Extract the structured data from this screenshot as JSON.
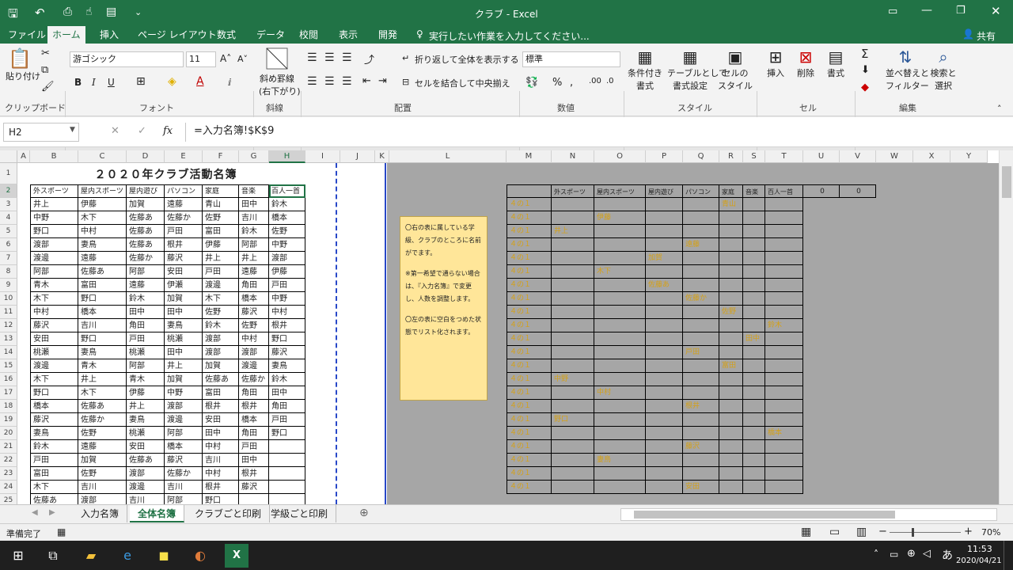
{
  "window": {
    "title": "クラブ - Excel",
    "share": "共有"
  },
  "tabs": [
    "ファイル",
    "ホーム",
    "挿入",
    "ページ レイアウト",
    "数式",
    "データ",
    "校閲",
    "表示",
    "開発"
  ],
  "tell_me": "実行したい作業を入力してください...",
  "ribbon": {
    "paste": "貼り付け",
    "clipboard": "クリップボード",
    "font_name": "游ゴシック",
    "font_size": "11",
    "font": "フォント",
    "diagonal": "斜め罫線",
    "diagonal2": "(右下がり)",
    "diagonal_group": "斜線",
    "wrap": "折り返して全体を表示する",
    "merge": "セルを結合して中央揃え",
    "alignment": "配置",
    "number_format": "標準",
    "number": "数値",
    "cond_format": "条件付き",
    "cond_format2": "書式",
    "table_format": "テーブルとして",
    "table_format2": "書式設定",
    "cell_style": "セルの",
    "cell_style2": "スタイル",
    "style": "スタイル",
    "insert": "挿入",
    "delete": "削除",
    "format": "書式",
    "cells": "セル",
    "sort": "並べ替えと",
    "sort2": "フィルター",
    "find": "検索と",
    "find2": "選択",
    "editing": "編集",
    "bold": "B",
    "italic": "I",
    "underline": "U"
  },
  "formula_bar": {
    "name_box": "H2",
    "formula": "=入力名簿!$K$9"
  },
  "columns": [
    "A",
    "B",
    "C",
    "D",
    "E",
    "F",
    "G",
    "H",
    "I",
    "J",
    "K",
    "L",
    "M",
    "N",
    "O",
    "P",
    "Q",
    "R",
    "S",
    "T",
    "U",
    "V",
    "W",
    "X",
    "Y"
  ],
  "rows": [
    "1",
    "2",
    "3",
    "4",
    "5",
    "6",
    "7",
    "8",
    "9",
    "10",
    "11",
    "12",
    "13",
    "14",
    "15",
    "16",
    "17",
    "18",
    "19",
    "20",
    "21",
    "22",
    "23",
    "24",
    "25"
  ],
  "table_title": "２０２０年クラブ活動名簿",
  "left_headers": [
    "外スポーツ",
    "屋内スポーツ",
    "屋内遊び",
    "パソコン",
    "家庭",
    "音楽",
    "百人一首"
  ],
  "left_rows": [
    [
      "井上",
      "伊藤",
      "加賀",
      "遠藤",
      "青山",
      "田中",
      "鈴木"
    ],
    [
      "中野",
      "木下",
      "佐藤あ",
      "佐藤か",
      "佐野",
      "吉川",
      "橋本"
    ],
    [
      "野口",
      "中村",
      "佐藤あ",
      "戸田",
      "富田",
      "鈴木",
      "佐野"
    ],
    [
      "渡部",
      "妻鳥",
      "佐藤あ",
      "根井",
      "伊藤",
      "阿部",
      "中野"
    ],
    [
      "渡邊",
      "遠藤",
      "佐藤か",
      "藤沢",
      "井上",
      "井上",
      "渡部"
    ],
    [
      "阿部",
      "佐藤あ",
      "阿部",
      "安田",
      "戸田",
      "遠藤",
      "伊藤"
    ],
    [
      "青木",
      "富田",
      "遠藤",
      "伊瀬",
      "渡邊",
      "角田",
      "戸田"
    ],
    [
      "木下",
      "野口",
      "鈴木",
      "加賀",
      "木下",
      "橋本",
      "中野"
    ],
    [
      "中村",
      "橋本",
      "田中",
      "田中",
      "佐野",
      "藤沢",
      "中村"
    ],
    [
      "藤沢",
      "吉川",
      "角田",
      "妻鳥",
      "鈴木",
      "佐野",
      "根井"
    ],
    [
      "安田",
      "野口",
      "戸田",
      "桃瀬",
      "渡部",
      "中村",
      "野口"
    ],
    [
      "桃瀬",
      "妻鳥",
      "桃瀬",
      "田中",
      "渡部",
      "渡部",
      "藤沢"
    ],
    [
      "渡邊",
      "青木",
      "阿部",
      "井上",
      "加賀",
      "渡邊",
      "妻鳥"
    ],
    [
      "木下",
      "井上",
      "青木",
      "加賀",
      "佐藤あ",
      "佐藤か",
      "鈴木"
    ],
    [
      "野口",
      "木下",
      "伊藤",
      "中野",
      "富田",
      "角田",
      "田中"
    ],
    [
      "橋本",
      "佐藤あ",
      "井上",
      "渡部",
      "根井",
      "根井",
      "角田"
    ],
    [
      "藤沢",
      "佐藤か",
      "妻鳥",
      "渡邊",
      "安田",
      "橋本",
      "戸田"
    ],
    [
      "妻鳥",
      "佐野",
      "桃瀬",
      "阿部",
      "田中",
      "角田",
      "野口"
    ],
    [
      "鈴木",
      "遠藤",
      "安田",
      "橋本",
      "中村",
      "戸田",
      ""
    ],
    [
      "戸田",
      "加賀",
      "佐藤あ",
      "藤沢",
      "吉川",
      "田中",
      ""
    ],
    [
      "富田",
      "佐野",
      "渡部",
      "佐藤か",
      "中村",
      "根井",
      ""
    ],
    [
      "木下",
      "吉川",
      "渡邊",
      "吉川",
      "根井",
      "藤沢",
      ""
    ],
    [
      "佐藤あ",
      "渡部",
      "吉川",
      "阿部",
      "野口",
      "",
      ""
    ]
  ],
  "note_box": [
    "〇右の表に属している学級、クラブのところに名前がでます。",
    "※第一希望で通らない場合は、『入力名簿』で変更し、人数を調整します。",
    "〇左の表に空白をつめた状態でリスト化されます。"
  ],
  "right_headers": [
    "",
    "外スポーツ",
    "屋内スポーツ",
    "屋内遊び",
    "パソコン",
    "家庭",
    "音楽",
    "百人一首"
  ],
  "right_zero": [
    "0",
    "0"
  ],
  "right_rows": [
    {
      "label": "４の１",
      "col": 5,
      "name": "青山"
    },
    {
      "label": "４の１",
      "col": 2,
      "name": "伊藤"
    },
    {
      "label": "４の１",
      "col": 1,
      "name": "井上"
    },
    {
      "label": "４の１",
      "col": 4,
      "name": "遠藤"
    },
    {
      "label": "４の１",
      "col": 3,
      "name": "加賀"
    },
    {
      "label": "４の１",
      "col": 2,
      "name": "木下"
    },
    {
      "label": "４の１",
      "col": 3,
      "name": "佐藤あ"
    },
    {
      "label": "４の１",
      "col": 4,
      "name": "佐藤か"
    },
    {
      "label": "４の１",
      "col": 5,
      "name": "佐野"
    },
    {
      "label": "４の１",
      "col": 7,
      "name": "鈴木"
    },
    {
      "label": "４の１",
      "col": 6,
      "name": "田中"
    },
    {
      "label": "４の１",
      "col": 4,
      "name": "戸田"
    },
    {
      "label": "４の１",
      "col": 5,
      "name": "富田"
    },
    {
      "label": "４の１",
      "col": 1,
      "name": "中野"
    },
    {
      "label": "４の１",
      "col": 2,
      "name": "中村"
    },
    {
      "label": "４の１",
      "col": 4,
      "name": "根井"
    },
    {
      "label": "４の１",
      "col": 1,
      "name": "野口"
    },
    {
      "label": "４の１",
      "col": 7,
      "name": "橋本"
    },
    {
      "label": "４の１",
      "col": 4,
      "name": "藤沢"
    },
    {
      "label": "４の１",
      "col": 2,
      "name": "妻鳥"
    },
    {
      "label": "４の１",
      "col": 0,
      "name": ""
    },
    {
      "label": "４の１",
      "col": 4,
      "name": "安田"
    }
  ],
  "sheets": [
    "入力名簿",
    "全体名簿",
    "クラブごと印刷",
    "学級ごと印刷"
  ],
  "status": {
    "ready": "準備完了",
    "zoom": "70%"
  },
  "clock": {
    "time": "11:53",
    "date": "2020/04/21"
  },
  "colors": {
    "excel_green": "#217346",
    "name_gold": "#d4a017",
    "note_bg": "#ffe699",
    "dark_area": "#a6a6a6"
  }
}
